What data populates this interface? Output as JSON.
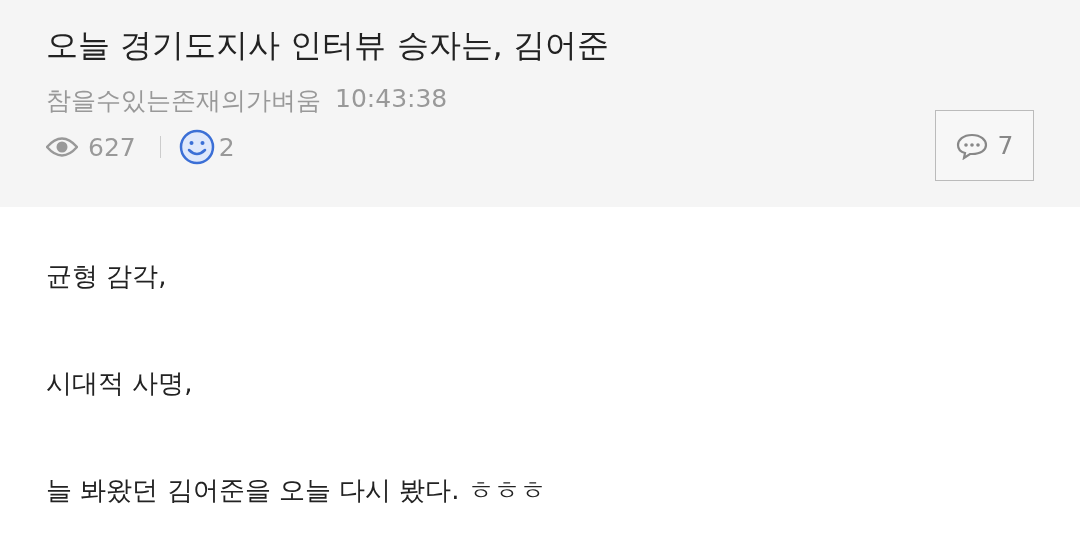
{
  "post": {
    "title": "오늘 경기도지사 인터뷰 승자는, 김어준",
    "author": "참을수있는존재의가벼움",
    "time": "10:43:38",
    "views": "627",
    "likes": "2",
    "comments": "7"
  },
  "body": [
    "균형 감각,",
    "시대적 사명,",
    "늘 봐왔던 김어준을 오늘 다시 봤다. ㅎㅎㅎ"
  ]
}
